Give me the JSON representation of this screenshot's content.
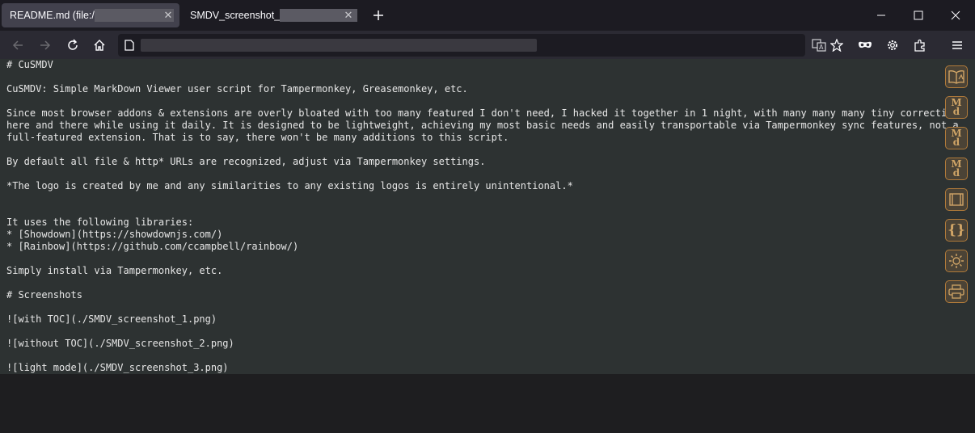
{
  "tabs": [
    {
      "title": "README.md (file:/",
      "close": "✕"
    },
    {
      "title": "SMDV_screenshot_",
      "close": "✕"
    }
  ],
  "new_tab_label": "+",
  "window_controls": {
    "minimize": "—",
    "maximize": "☐",
    "close": "✕"
  },
  "nav": {
    "back_icon": "arrow-left-icon",
    "forward_icon": "arrow-right-icon",
    "reload_icon": "reload-icon",
    "home_icon": "home-icon",
    "url": ""
  },
  "markdown_lines": [
    "# CuSMDV",
    "",
    "CuSMDV: Simple MarkDown Viewer user script for Tampermonkey, Greasemonkey, etc.",
    "",
    "Since most browser addons & extensions are overly bloated with too many featured I don't need, I hacked it together in 1 night, with many many many tiny corrections",
    "here and there while using it daily. It is designed to be lightweight, achieving my most basic needs and easily transportable via Tampermonkey sync features, not a",
    "full-featured extension. That is to say, there won't be many additions to this script.",
    "",
    "By default all file & http* URLs are recognized, adjust via Tampermonkey settings.",
    "",
    "*The logo is created by me and any similarities to any existing logos is entirely unintentional.*",
    "",
    "",
    "It uses the following libraries:",
    "* [Showdown](https://showdownjs.com/)",
    "* [Rainbow](https://github.com/ccampbell/rainbow/)",
    "",
    "Simply install via Tampermonkey, etc.",
    "",
    "# Screenshots",
    "",
    "![with TOC](./SMDV_screenshot_1.png)",
    "",
    "![without TOC](./SMDV_screenshot_2.png)",
    "",
    "![light mode](./SMDV_screenshot_3.png)"
  ],
  "side_buttons": [
    {
      "name": "toc-book-icon",
      "label": ""
    },
    {
      "name": "markdown-mode-button",
      "label": "M\nd"
    },
    {
      "name": "markdown-mode-button-2",
      "label": "M\nd"
    },
    {
      "name": "markdown-mode-button-3",
      "label": "M\nd"
    },
    {
      "name": "fullwidth-icon",
      "label": ""
    },
    {
      "name": "code-braces-button",
      "label": "{}"
    },
    {
      "name": "light-mode-icon",
      "label": ""
    },
    {
      "name": "print-icon",
      "label": ""
    }
  ],
  "colors": {
    "accent": "#b07a3a",
    "page_bg": "#2d3232",
    "text": "#e7e7e7"
  }
}
